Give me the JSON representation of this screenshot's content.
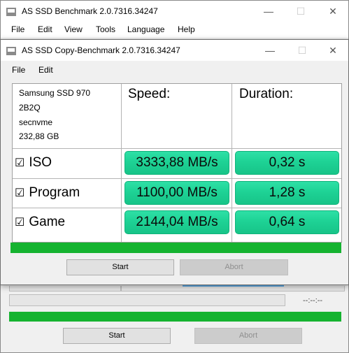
{
  "main_window": {
    "title": "AS SSD Benchmark 2.0.7316.34247",
    "menu": [
      "File",
      "Edit",
      "View",
      "Tools",
      "Language",
      "Help"
    ],
    "controls": {
      "minimize": "—",
      "maximize": "☐",
      "close": "✕"
    },
    "time_readout": "--:--:--",
    "start_label": "Start",
    "abort_label": "Abort"
  },
  "dialog": {
    "title": "AS SSD Copy-Benchmark 2.0.7316.34247",
    "menu": [
      "File",
      "Edit"
    ],
    "controls": {
      "minimize": "—",
      "maximize": "☐",
      "close": "✕"
    },
    "drive": {
      "model": "Samsung SSD 970",
      "firmware": "2B2Q",
      "driver": "secnvme",
      "size": "232,88 GB"
    },
    "headers": {
      "speed": "Speed:",
      "duration": "Duration:"
    },
    "rows": [
      {
        "label": "ISO",
        "checked": true,
        "check_mark": "☑",
        "speed": "3333,88 MB/s",
        "duration": "0,32 s"
      },
      {
        "label": "Program",
        "checked": true,
        "check_mark": "☑",
        "speed": "1100,00 MB/s",
        "duration": "1,28 s"
      },
      {
        "label": "Game",
        "checked": true,
        "check_mark": "☑",
        "speed": "2144,04 MB/s",
        "duration": "0,64 s"
      }
    ],
    "progress": 1.0,
    "start_label": "Start",
    "abort_label": "Abort"
  },
  "colors": {
    "progress_green": "#15b330",
    "result_green": "#1ed295"
  }
}
